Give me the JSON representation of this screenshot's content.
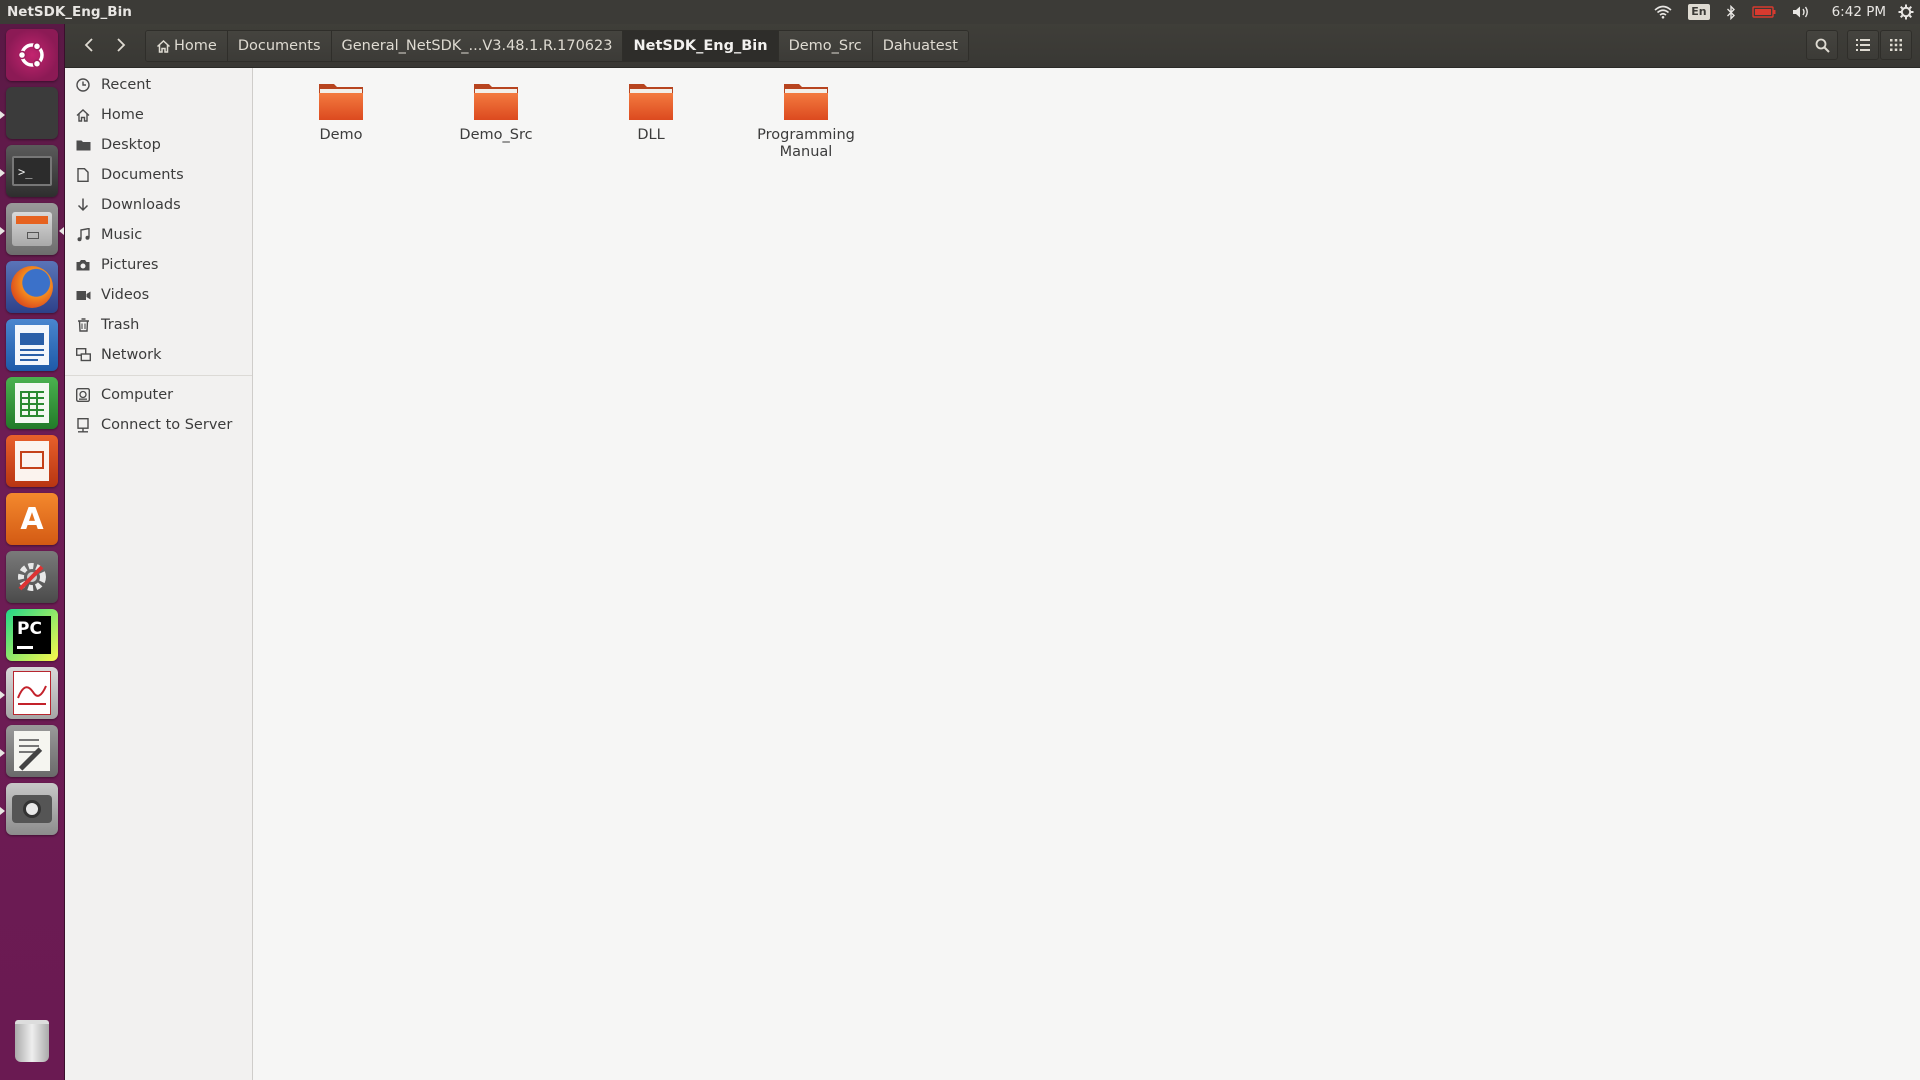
{
  "window": {
    "title": "NetSDK_Eng_Bin"
  },
  "tray": {
    "language": "En",
    "time": "6:42 PM"
  },
  "breadcrumbs": [
    {
      "label": "Home",
      "icon": "home-icon"
    },
    {
      "label": "Documents"
    },
    {
      "label": "General_NetSDK_...V3.48.1.R.170623"
    },
    {
      "label": "NetSDK_Eng_Bin",
      "active": true
    },
    {
      "label": "Demo_Src"
    },
    {
      "label": "Dahuatest"
    }
  ],
  "sidebar": {
    "places": [
      {
        "label": "Recent",
        "icon": "clock-icon"
      },
      {
        "label": "Home",
        "icon": "home-icon"
      },
      {
        "label": "Desktop",
        "icon": "folder-icon"
      },
      {
        "label": "Documents",
        "icon": "document-icon"
      },
      {
        "label": "Downloads",
        "icon": "download-icon"
      },
      {
        "label": "Music",
        "icon": "music-icon"
      },
      {
        "label": "Pictures",
        "icon": "camera-icon"
      },
      {
        "label": "Videos",
        "icon": "video-icon"
      },
      {
        "label": "Trash",
        "icon": "trash-icon"
      },
      {
        "label": "Network",
        "icon": "network-icon"
      }
    ],
    "devices": [
      {
        "label": "Computer",
        "icon": "computer-icon"
      },
      {
        "label": "Connect to Server",
        "icon": "server-icon"
      }
    ]
  },
  "files": [
    {
      "name": "Demo",
      "type": "folder"
    },
    {
      "name": "Demo_Src",
      "type": "folder"
    },
    {
      "name": "DLL",
      "type": "folder"
    },
    {
      "name": "Programming Manual",
      "type": "folder"
    }
  ],
  "colors": {
    "folder": "#e8552a",
    "launcher": "#6e1d55",
    "panel": "#3c3b37"
  }
}
